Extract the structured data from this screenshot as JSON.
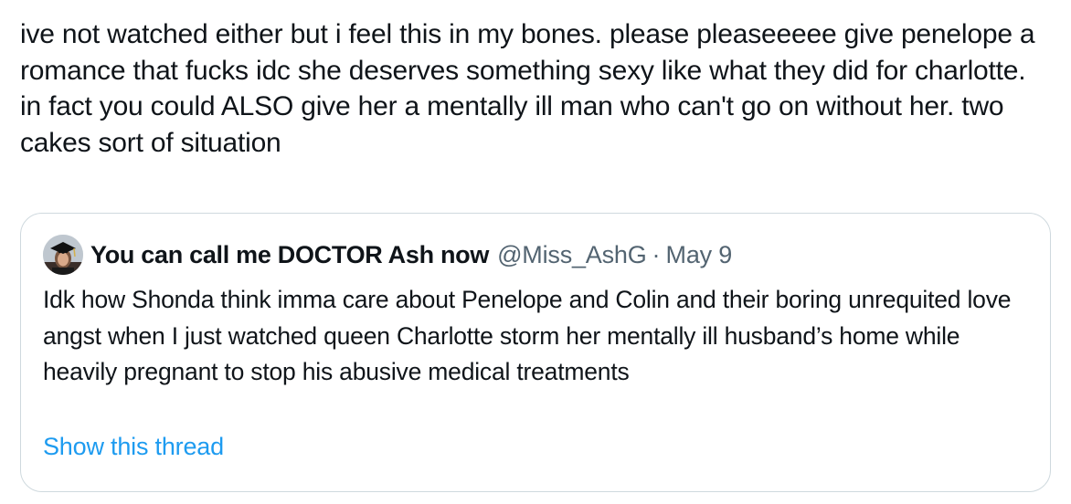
{
  "tweet": {
    "text": "ive not watched either but i feel this in my bones. please pleaseeeee give penelope a romance that fucks idc she deserves something sexy like what they did for charlotte. in fact you could ALSO give her a mentally ill man who can't go on without her. two cakes sort of situation"
  },
  "quoted_tweet": {
    "author_name": "You can call me DOCTOR Ash now",
    "author_handle": "@Miss_AshG",
    "separator": "·",
    "date": "May 9",
    "avatar_icon": "graduation-cap-avatar",
    "text": "Idk how Shonda think imma care about Penelope and Colin and their boring unrequited love angst when I just watched queen Charlotte storm her mentally ill husband’s home while heavily pregnant to stop his abusive medical treatments",
    "show_thread_label": "Show this thread"
  },
  "colors": {
    "text_primary": "#0f1419",
    "text_secondary": "#536471",
    "link": "#1d9bf0",
    "border": "#cfd9de"
  }
}
